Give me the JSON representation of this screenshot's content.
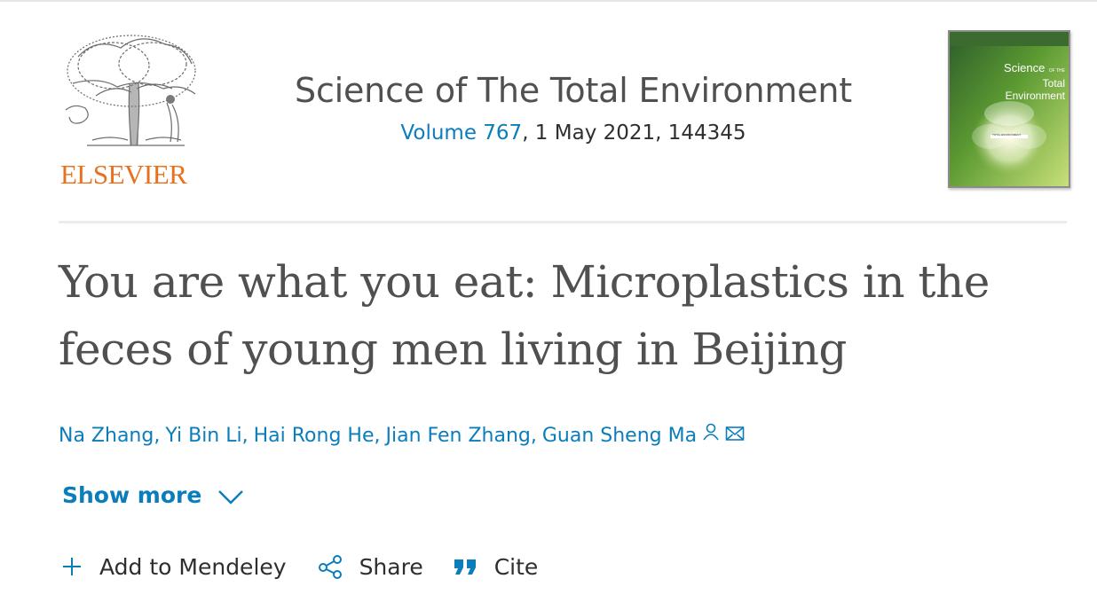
{
  "header": {
    "publisher": "ELSEVIER",
    "journal_title": "Science of The Total Environment",
    "volume_link": "Volume 767",
    "issue_rest": ", 1 May 2021, 144345",
    "cover": {
      "title_line1": "Science",
      "title_small": "OF THE",
      "title_line2": "Total Environment",
      "band_text": "TOTAL ENVIRONMENT"
    }
  },
  "article": {
    "title": "You are what you eat: Microplastics in the feces of young men living in Beijing"
  },
  "authors": [
    {
      "name": "Na Zhang"
    },
    {
      "name": "Yi Bin Li"
    },
    {
      "name": "Hai Rong He"
    },
    {
      "name": "Jian Fen Zhang"
    },
    {
      "name": "Guan Sheng Ma"
    }
  ],
  "author_separator": ",",
  "show_more": {
    "label": "Show more"
  },
  "actions": {
    "mendeley": "Add to Mendeley",
    "share": "Share",
    "cite": "Cite"
  },
  "colors": {
    "link": "#0c7dbb",
    "elsevier_orange": "#e9711c",
    "title_gray": "#505050"
  },
  "icons": {
    "author": "person-icon",
    "email": "envelope-icon",
    "chevron": "chevron-down-icon",
    "add": "plus-icon",
    "share": "share-icon",
    "cite": "quote-icon"
  }
}
